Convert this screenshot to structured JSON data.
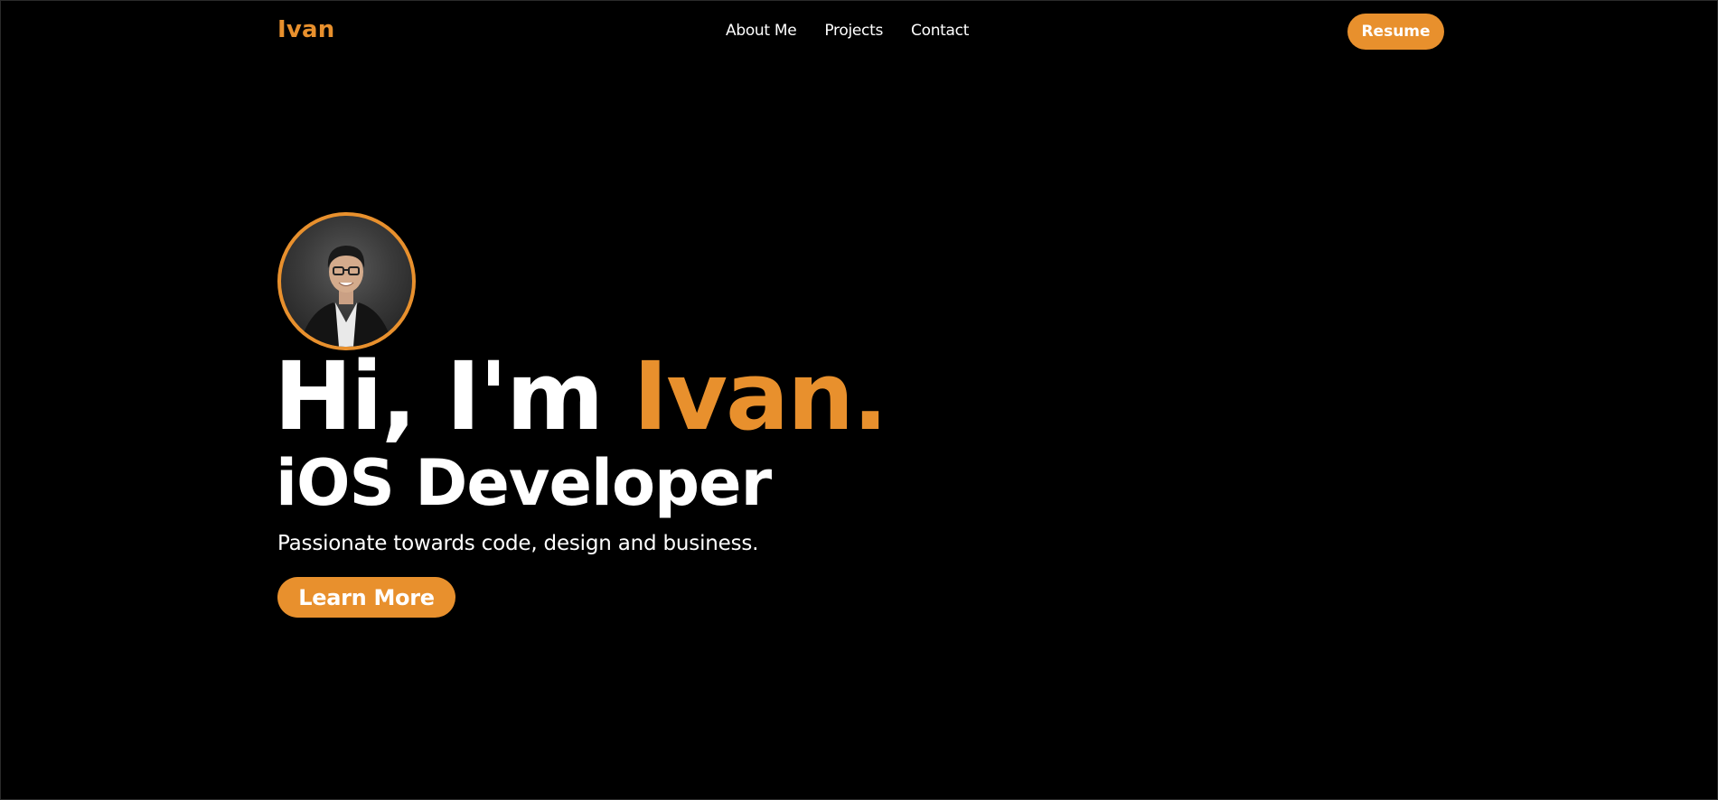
{
  "header": {
    "logo": "Ivan",
    "nav": [
      {
        "label": "About Me"
      },
      {
        "label": "Projects"
      },
      {
        "label": "Contact"
      }
    ],
    "resume_label": "Resume"
  },
  "hero": {
    "greeting": "Hi, I'm ",
    "name": "Ivan",
    "name_dot": ".",
    "role": "iOS Developer",
    "tagline": "Passionate towards code, design and business.",
    "cta_label": "Learn More"
  },
  "colors": {
    "accent": "#E8902D",
    "background": "#000000",
    "text": "#FFFFFF"
  }
}
